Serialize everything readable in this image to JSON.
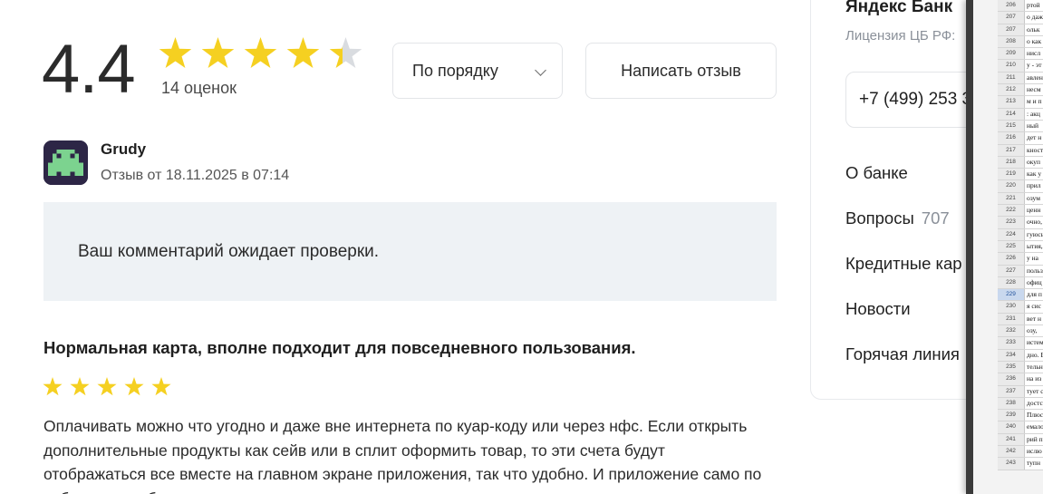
{
  "rating": {
    "value": "4.4",
    "stars_filled": 4.4,
    "count_label": "14 оценок",
    "star_color": "#f5d021",
    "star_empty_color": "#d9dce0"
  },
  "controls": {
    "sort_label": "По порядку",
    "write_review_label": "Написать отзыв"
  },
  "review": {
    "author": "Grudy",
    "date": "Отзыв от 18.11.2025 в 07:14",
    "moderation_notice": "Ваш комментарий ожидает проверки.",
    "title": "Нормальная карта, вполне подходит для повседневного пользования.",
    "stars": 5,
    "body": "Оплачивать можно что угодно и даже вне интернета по куар-коду или через нфс. Если открыть дополнительные продукты как сейв или в сплит оформить товар, то эти счета будут отображаться все вместе на главном экране приложения, так что удобно. И приложение само по себе тоже удобное и внешне симпатичное."
  },
  "sidebar": {
    "bank_name": "Яндекс Банк",
    "license": "Лицензия ЦБ РФ:",
    "phone": "+7 (499) 253 3",
    "nav": [
      {
        "label": "О банке",
        "count": ""
      },
      {
        "label": "Вопросы",
        "count": "707"
      },
      {
        "label": "Кредитные кар",
        "count": ""
      },
      {
        "label": "Новости",
        "count": ""
      },
      {
        "label": "Горячая линия",
        "count": ""
      }
    ]
  },
  "sheet": {
    "active_row": "229",
    "rows": [
      {
        "n": "206",
        "t": "ртой"
      },
      {
        "n": "207",
        "t": "о даж"
      },
      {
        "n": "207",
        "t": "ольк"
      },
      {
        "n": "208",
        "t": "о как"
      },
      {
        "n": "209",
        "t": "нисл"
      },
      {
        "n": "210",
        "t": "у - эт"
      },
      {
        "n": "211",
        "t": "авлен"
      },
      {
        "n": "212",
        "t": "несм"
      },
      {
        "n": "213",
        "t": "м и п"
      },
      {
        "n": "214",
        "t": ": акц"
      },
      {
        "n": "215",
        "t": "ный"
      },
      {
        "n": "216",
        "t": "дет н"
      },
      {
        "n": "217",
        "t": "кност"
      },
      {
        "n": "218",
        "t": "окуп"
      },
      {
        "n": "219",
        "t": " как у"
      },
      {
        "n": "220",
        "t": " прил"
      },
      {
        "n": "221",
        "t": "озум"
      },
      {
        "n": "222",
        "t": "ценн"
      },
      {
        "n": "223",
        "t": "очно,"
      },
      {
        "n": "224",
        "t": "гуюсь"
      },
      {
        "n": "225",
        "t": "ытия,"
      },
      {
        "n": "226",
        "t": "у на"
      },
      {
        "n": "227",
        "t": "польз"
      },
      {
        "n": "228",
        "t": "офиц"
      },
      {
        "n": "229",
        "t": "для п"
      },
      {
        "n": "230",
        "t": "я сис"
      },
      {
        "n": "231",
        "t": "вет н"
      },
      {
        "n": "232",
        "t": "озу,"
      },
      {
        "n": "233",
        "t": "истем"
      },
      {
        "n": "234",
        "t": "дно. В"
      },
      {
        "n": "235",
        "t": "тельн"
      },
      {
        "n": "236",
        "t": "на из"
      },
      {
        "n": "237",
        "t": "тует с"
      },
      {
        "n": "238",
        "t": "достс"
      },
      {
        "n": "239",
        "t": "Плюс"
      },
      {
        "n": "240",
        "t": "емало"
      },
      {
        "n": "241",
        "t": "рий п"
      },
      {
        "n": "242",
        "t": "ислю"
      },
      {
        "n": "243",
        "t": "тупн"
      }
    ]
  }
}
